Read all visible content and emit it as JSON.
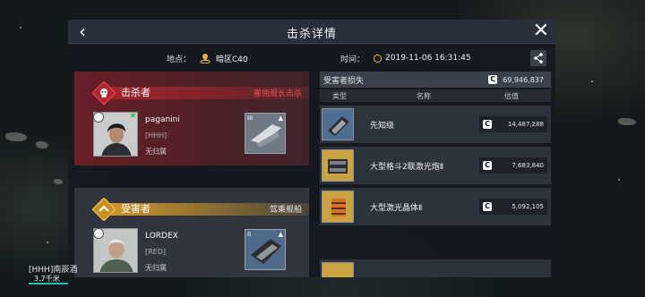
{
  "header": {
    "title": "击杀详情"
  },
  "info": {
    "location_label": "地点：",
    "location_value": "暗区C40",
    "time_label": "时间：",
    "time_value": "2019-11-06 16:31:45"
  },
  "killer": {
    "role_title": "击杀者",
    "role_note": "雇佣舰长击杀",
    "name": "paganini",
    "corp": "[HHH]",
    "alliance": "无归属",
    "ship_tier": "III"
  },
  "victim": {
    "role_title": "受害者",
    "role_note": "驾乘舰船",
    "name": "LORDEX",
    "corp": "[RED]",
    "alliance": "无归属",
    "ship_tier": "II"
  },
  "losses": {
    "title": "受害者损失",
    "currency_symbol": "C",
    "total": "69,946,837",
    "columns": {
      "type": "类型",
      "name": "名称",
      "value": "估值"
    },
    "items": [
      {
        "name": "先知级",
        "value": "14,487,288",
        "tier": "II"
      },
      {
        "name": "大型格斗2联激光炮Ⅱ",
        "value": "7,683,840",
        "tier": "II"
      },
      {
        "name": "大型激光晶体Ⅱ",
        "value": "5,092,105",
        "tier": "II"
      }
    ]
  },
  "hud": {
    "label": "[HHH]南辰酒",
    "distance": "3.7千米"
  },
  "colors": {
    "killer_red": "#a3262d",
    "victim_gold": "#d49a28",
    "accent_teal": "#27c2b5"
  }
}
